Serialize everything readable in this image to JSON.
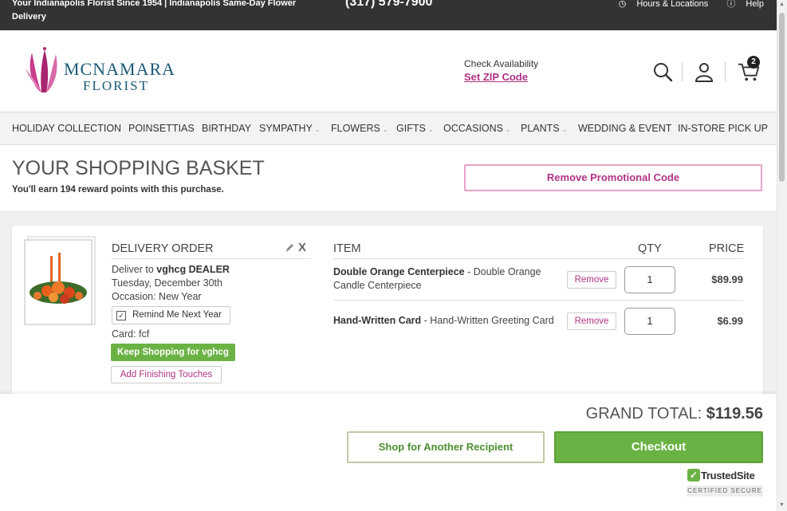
{
  "topbar": {
    "tagline": "Your Indianapolis Florist Since 1954 | Indianapolis Same-Day Flower Delivery",
    "phone": "(317) 579-7900",
    "hours_label": "Hours & Locations",
    "help_label": "Help"
  },
  "header": {
    "logo_line1": "MCNAMARA",
    "logo_line2": "FLORIST",
    "check_availability": "Check Availability",
    "set_zip": "Set ZIP Code",
    "cart_count": "2"
  },
  "nav": {
    "items": [
      {
        "label": "HOLIDAY COLLECTION"
      },
      {
        "label": "POINSETTIAS"
      },
      {
        "label": "BIRTHDAY"
      },
      {
        "label": "SYMPATHY"
      },
      {
        "label": "FLOWERS"
      },
      {
        "label": "GIFTS"
      },
      {
        "label": "OCCASIONS"
      },
      {
        "label": "PLANTS"
      },
      {
        "label": "WEDDING & EVENT"
      },
      {
        "label": "IN-STORE PICK UP"
      }
    ]
  },
  "page": {
    "title": "YOUR SHOPPING BASKET",
    "reward_text": "You'll earn 194 reward points with this purchase.",
    "remove_promo": "Remove Promotional Code"
  },
  "order": {
    "heading": "DELIVERY ORDER",
    "deliver_prefix": "Deliver to ",
    "recipient": "vghcg DEALER",
    "date": "Tuesday, December 30th",
    "occasion": "Occasion: New Year",
    "remind": "Remind Me Next Year",
    "card": "Card: fcf",
    "keep_shopping": "Keep Shopping for vghcg",
    "finishing": "Add Finishing Touches"
  },
  "items_table": {
    "col_item": "ITEM",
    "col_qty": "QTY",
    "col_price": "PRICE",
    "remove_label": "Remove",
    "rows": [
      {
        "name": "Double Orange Centerpiece",
        "desc": " - Double Orange Candle Centerpiece",
        "qty": "1",
        "price": "$89.99"
      },
      {
        "name": "Hand-Written Card",
        "desc": " - Hand-Written Greeting Card",
        "qty": "1",
        "price": "$6.99"
      }
    ]
  },
  "footer": {
    "grand_total_label": "GRAND TOTAL: ",
    "grand_total_value": "$119.56",
    "another_recipient": "Shop for Another Recipient",
    "checkout": "Checkout",
    "trusted_name": "TrustedSite",
    "trusted_sub": "CERTIFIED SECURE"
  },
  "colors": {
    "accent_pink": "#b03285",
    "green": "#6bb244",
    "dark_bar": "#333333",
    "brand_blue": "#1d5a78"
  },
  "icons": [
    "search-icon",
    "user-icon",
    "cart-icon",
    "clock-icon",
    "help-icon",
    "pencil-icon",
    "close-icon",
    "check-icon"
  ]
}
